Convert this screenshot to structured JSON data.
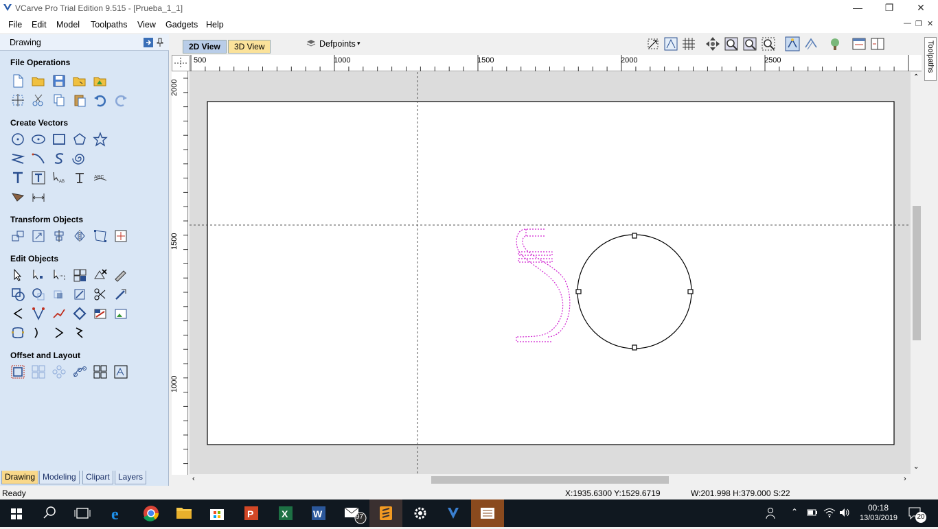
{
  "window": {
    "title": "VCarve Pro Trial Edition 9.515 - [Prueba_1_1]"
  },
  "menu": {
    "items": [
      "File",
      "Edit",
      "Model",
      "Toolpaths",
      "View",
      "Gadgets",
      "Help"
    ]
  },
  "left_panel": {
    "title": "Drawing",
    "sections": {
      "file_operations": "File Operations",
      "create_vectors": "Create Vectors",
      "transform_objects": "Transform Objects",
      "edit_objects": "Edit Objects",
      "offset_layout": "Offset and Layout"
    },
    "bottom_tabs": [
      "Drawing",
      "Modeling",
      "Clipart",
      "Layers"
    ],
    "active_tab": "Drawing"
  },
  "view_tabs": {
    "tab_2d": "2D View",
    "tab_3d": "3D View",
    "active": "2D View"
  },
  "layer_selector": "Defpoints",
  "right_tab": "Toolpaths",
  "rulers": {
    "horizontal": [
      "500",
      "1000",
      "1500",
      "2000",
      "2500"
    ],
    "vertical": [
      "2000",
      "1500",
      "1000"
    ]
  },
  "status": {
    "left": "Ready",
    "coords": "X:1935.6300 Y:1529.6719",
    "dims": "W:201.998  H:379.000  S:22"
  },
  "taskbar": {
    "time": "00:18",
    "date": "13/03/2019",
    "mail_badge": "97",
    "notification_count": "20"
  },
  "colors": {
    "panel_bg": "#d9e6f5",
    "active_tab": "#f9d88a",
    "vector_selected": "#d020d0",
    "taskbar": "#101820"
  }
}
